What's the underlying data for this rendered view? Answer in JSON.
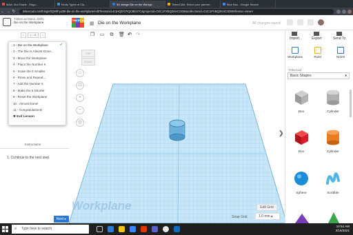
{
  "browser": {
    "tabs": [
      {
        "label": "MAA: 2nd Grade - Edgu..."
      },
      {
        "label": "Kinds Types of Cla..."
      },
      {
        "label": "3D design Die on the Workpl..."
      },
      {
        "label": "TinkerCAD: Select your partner..."
      },
      {
        "label": "Blue Box - Google Search"
      }
    ],
    "url": "tinkercad.com/things/0QWlFyx28i-die-on-the-workplane/edit?lessonid=E1HQDO7IQCBES7C&projectid=O2C1PXBQ2KHCODB&collectionid=O2C1PXBQ2KHCODB#/lesson-viewer"
  },
  "header": {
    "lesson_category": "Tinkercad Basic Skills",
    "lesson_name": "Die on the Workplane",
    "logo_letters": [
      "TIN",
      "KER",
      "CAD",
      "",
      "",
      ""
    ],
    "logo_colors": [
      "#e64434",
      "#2a78d6",
      "#f5b000",
      "#44a04b",
      "#7c3ab4",
      "#e64434"
    ],
    "design_title": "Die on the Workplane",
    "save_status": "All changes saved"
  },
  "lesson": {
    "prev": "‹",
    "next": "›",
    "counter": "1 / 11",
    "steps": [
      "1 - Die on the Workplane",
      "2 - The Die Is Almost Done...",
      "3 - Move the Workplane",
      "4 - Place the Number 5",
      "5 - Scale the 5 Smaller",
      "6 - Rinse and Repeat...",
      "7 - Add the Number 6",
      "8 - Make the 6 Shorter",
      "9 - Reset the Workplane",
      "10 - Almost Done!",
      "11 - Congratulations!"
    ],
    "exit_label": "Exit Lesson",
    "instructions_tab": "Instructions",
    "instruction_text": "1. Continue to the next step.",
    "next_button": "Next ▸"
  },
  "toolbar": {
    "undo": "↶",
    "redo": "↷"
  },
  "workspace": {
    "viewcube_top": "TOP",
    "viewcube_front": "FRONT",
    "controls": [
      "⌂",
      "⊡",
      "+",
      "−",
      "◎"
    ],
    "grid_watermark": "Workplane",
    "edit_grid": "Edit Grid",
    "snap_grid_label": "Snap Grid",
    "snap_grid_value": "1.0 mm ▴"
  },
  "right_panel": {
    "top_buttons": [
      "Import",
      "Export",
      "Send To"
    ],
    "view_buttons": [
      "Workplane",
      "Ruler",
      "Notes"
    ],
    "library_label": "Tinkercad",
    "library_value": "Basic Shapes",
    "shapes": [
      {
        "name": "Box",
        "color": "#a9a9a9"
      },
      {
        "name": "Cylinder",
        "color": "#a9a9a9"
      },
      {
        "name": "Box",
        "color": "#d61f26"
      },
      {
        "name": "Cylinder",
        "color": "#ef7b1a"
      },
      {
        "name": "Sphere",
        "color": "#1a8cd8"
      },
      {
        "name": "Scribble",
        "color": "#56b3e6"
      }
    ]
  },
  "taskbar": {
    "search_placeholder": "Type here to search",
    "time": "10:54 AM",
    "date": "2/16/2021"
  }
}
